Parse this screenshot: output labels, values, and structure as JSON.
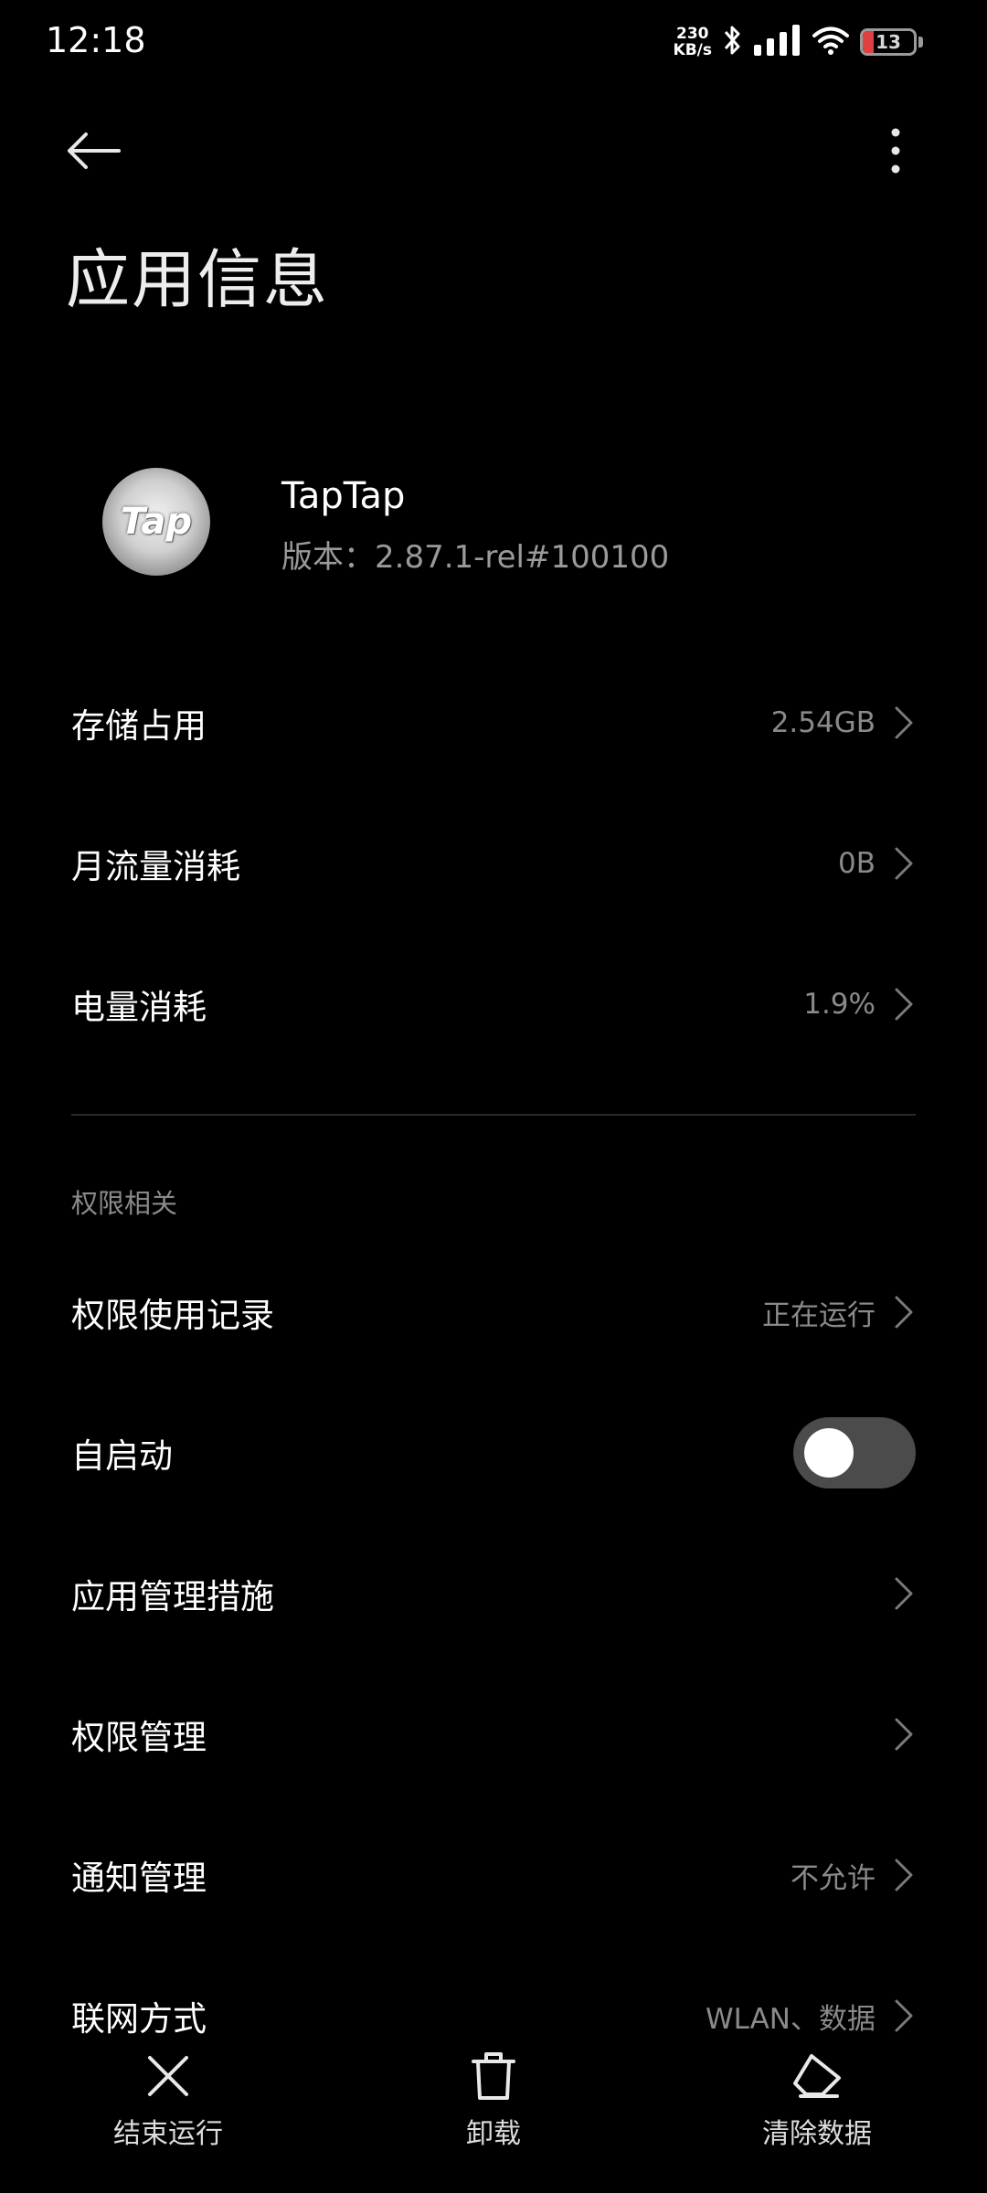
{
  "status_bar": {
    "time": "12:18",
    "net_speed_value": "230",
    "net_speed_unit": "KB/s",
    "battery_level": "13",
    "battery_color": "#e04040"
  },
  "header": {
    "back_icon": "arrow-left-icon",
    "more_icon": "more-vertical-icon",
    "title": "应用信息"
  },
  "app": {
    "icon_text": "Tap",
    "name": "TapTap",
    "version": "版本：2.87.1-rel#100100"
  },
  "usage_rows": [
    {
      "label": "存储占用",
      "value": "2.54GB"
    },
    {
      "label": "月流量消耗",
      "value": "0B"
    },
    {
      "label": "电量消耗",
      "value": "1.9%"
    }
  ],
  "permissions_section": {
    "header": "权限相关",
    "rows": [
      {
        "label": "权限使用记录",
        "value": "正在运行"
      },
      {
        "label": "自启动",
        "toggle_on": false
      },
      {
        "label": "应用管理措施",
        "value": ""
      },
      {
        "label": "权限管理",
        "value": ""
      },
      {
        "label": "通知管理",
        "value": "不允许"
      },
      {
        "label": "联网方式",
        "value": "WLAN、数据"
      }
    ]
  },
  "bottom_actions": [
    {
      "label": "结束运行",
      "icon": "close-icon"
    },
    {
      "label": "卸载",
      "icon": "trash-icon"
    },
    {
      "label": "清除数据",
      "icon": "eraser-icon"
    }
  ],
  "colors": {
    "background": "#000000",
    "secondary_text": "#8a8a8a",
    "toggle_off": "#4b4b4b"
  }
}
